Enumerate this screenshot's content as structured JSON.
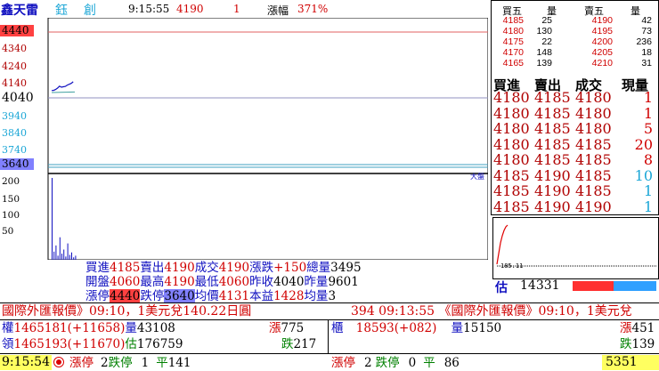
{
  "header": {
    "stock_name": "鑫天雷",
    "market_icon": "鈺",
    "board": "創",
    "time": "9:15:55",
    "price": "4190",
    "volume": "1",
    "change_label": "漲幅",
    "change_pct": "371%"
  },
  "chart": {
    "price_ticks": [
      "4440",
      "4340",
      "4240",
      "4140",
      "4040",
      "3940",
      "3840",
      "3740",
      "3640"
    ],
    "volume_ticks": [
      "200",
      "150",
      "100",
      "50"
    ],
    "volume_label": "大盤",
    "price_range": [
      3640,
      4440
    ],
    "line_points": [
      [
        0,
        4087
      ],
      [
        1,
        4088
      ],
      [
        2,
        4093
      ],
      [
        3,
        4102
      ],
      [
        4,
        4113
      ],
      [
        5,
        4107
      ],
      [
        6,
        4110
      ],
      [
        7,
        4112
      ],
      [
        8,
        4120
      ],
      [
        9,
        4125
      ],
      [
        10,
        4130
      ],
      [
        11,
        4140
      ]
    ],
    "volume_values": [
      200,
      20,
      35,
      10,
      55,
      15,
      25,
      8,
      40,
      12,
      18,
      6,
      10
    ],
    "colors": {
      "limit_up_bg": "#ff4040",
      "limit_down_bg": "#8080ff",
      "line": "#1010c0"
    }
  },
  "orderbook": {
    "headers": [
      "買五",
      "量",
      "賣五",
      "量"
    ],
    "rows": [
      [
        "4185",
        "25",
        "4190",
        "42"
      ],
      [
        "4180",
        "130",
        "4195",
        "73"
      ],
      [
        "4175",
        "22",
        "4200",
        "236"
      ],
      [
        "4170",
        "148",
        "4205",
        "18"
      ],
      [
        "4165",
        "139",
        "4210",
        "31"
      ]
    ]
  },
  "trades": {
    "headers": [
      "買進",
      "賣出",
      "成交",
      "現量"
    ],
    "rows": [
      [
        "4180",
        "4185",
        "4180",
        "1"
      ],
      [
        "4180",
        "4185",
        "4180",
        "1"
      ],
      [
        "4180",
        "4185",
        "4180",
        "5"
      ],
      [
        "4180",
        "4185",
        "4185",
        "20"
      ],
      [
        "4180",
        "4185",
        "4185",
        "8"
      ],
      [
        "4185",
        "4190",
        "4185",
        "10"
      ],
      [
        "4185",
        "4190",
        "4185",
        "1"
      ],
      [
        "4185",
        "4190",
        "4190",
        "1"
      ]
    ]
  },
  "mini": {
    "label": "185.11",
    "estimate_label": "估",
    "estimate_value": "14331",
    "bar_colors": [
      "#ff3030",
      "#30a0ff"
    ]
  },
  "summary": {
    "row1": {
      "l1": "買進",
      "v1": "4185",
      "l2": "賣出",
      "v2": "4190",
      "l3": "成交",
      "v3": "4190",
      "l4": "漲跌",
      "v4": "+150",
      "l5": "總量",
      "v5": "3495"
    },
    "row2": {
      "l1": "開盤",
      "v1": "4060",
      "l2": "最高",
      "v2": "4190",
      "l3": "最低",
      "v3": "4060",
      "l4": "昨收",
      "v4": "4040",
      "l5": "昨量",
      "v5": "9601"
    },
    "row3": {
      "l1": "漲停",
      "v1": "4440",
      "l2": "跌停",
      "v2": "3640",
      "l3": "均價",
      "v3": "4131",
      "l4": "本益",
      "v4": "1428",
      "l5": "均量",
      "v5": "3"
    }
  },
  "ticker": {
    "left": "國際外匯報價》09:10，1美元兌140.22日圓",
    "mid": "394 09:13:55 《國際外匯報價》09:10，1美元兌"
  },
  "market": {
    "row1": {
      "label": "權",
      "value": "1465181",
      "change": "(+11658)",
      "vol_label": "量",
      "vol": "43108",
      "up_label": "漲",
      "up": "775"
    },
    "row2": {
      "label": "領",
      "value": "1465193",
      "change": "(+11670)",
      "est_label": "估",
      "est": "176759",
      "down_label": "跌",
      "down": "217"
    },
    "otc": {
      "label": "櫃",
      "value": "18593",
      "change": "(+082)",
      "vol_label": "量",
      "vol": "15150",
      "up_label": "漲",
      "up": "451",
      "down_label": "跌",
      "down": "139"
    }
  },
  "status": {
    "time": "9:15:54",
    "lu_label": "漲停",
    "lu": "2",
    "ld_label": "跌停",
    "ld": "1",
    "flat_label": "平",
    "flat": "141",
    "lu2_label": "漲停",
    "lu2": "2",
    "ld2_label": "跌停",
    "ld2": "0",
    "flat2_label": "平",
    "flat2": "86",
    "right_value": "5351"
  }
}
